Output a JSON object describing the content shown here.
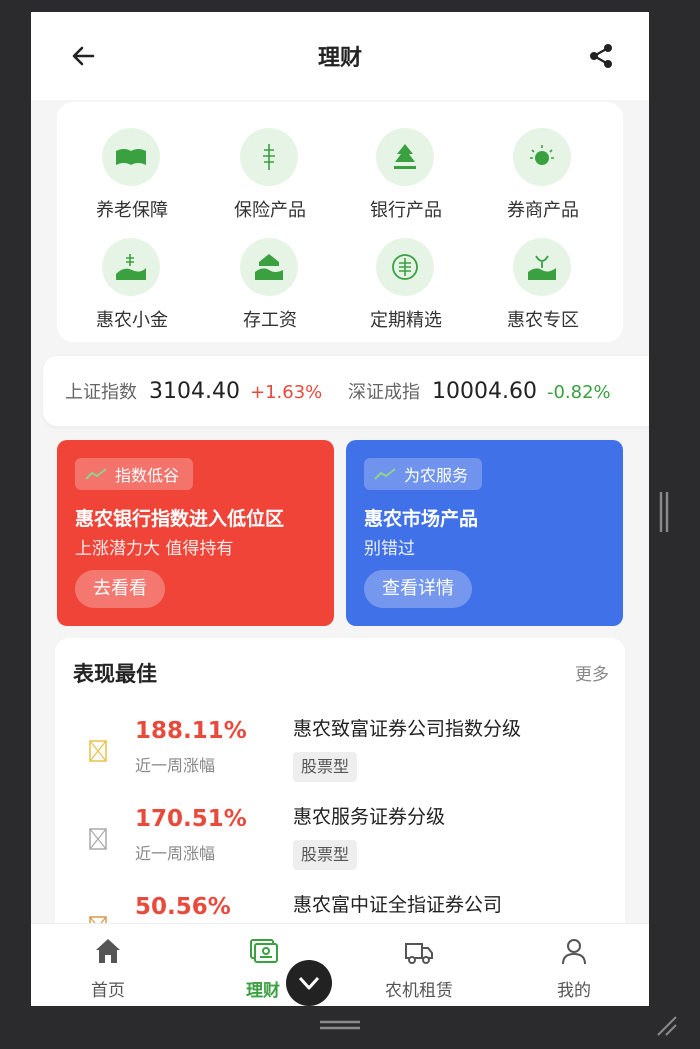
{
  "header": {
    "title": "理财",
    "back_icon": "arrow-left-icon",
    "share_icon": "share-icon"
  },
  "categories": [
    {
      "label": "养老保障",
      "icon": "pension-icon"
    },
    {
      "label": "保险产品",
      "icon": "insurance-icon"
    },
    {
      "label": "银行产品",
      "icon": "bank-icon"
    },
    {
      "label": "券商产品",
      "icon": "broker-icon"
    },
    {
      "label": "惠农小金",
      "icon": "small-gold-icon"
    },
    {
      "label": "存工资",
      "icon": "salary-icon"
    },
    {
      "label": "定期精选",
      "icon": "fixed-term-icon"
    },
    {
      "label": "惠农专区",
      "icon": "zone-icon"
    }
  ],
  "indices": [
    {
      "name": "上证指数",
      "value": "3104.40",
      "change": "+1.63%"
    },
    {
      "name": "深证成指",
      "value": "10004.60",
      "change": "-0.82%"
    }
  ],
  "promos": [
    {
      "tag": "指数低谷",
      "title": "惠农银行指数进入低位区",
      "subtitle": "上涨潜力大 值得持有",
      "button": "去看看",
      "color": "#f04438"
    },
    {
      "tag": "为农服务",
      "title": "惠农市场产品",
      "subtitle": "别错过",
      "button": "查看详情",
      "color": "#4171e8"
    }
  ],
  "best": {
    "title": "表现最佳",
    "more": "更多",
    "items": [
      {
        "pct": "188.11%",
        "period": "近一周涨幅",
        "name": "惠农致富证券公司指数分级",
        "type": "股票型"
      },
      {
        "pct": "170.51%",
        "period": "近一周涨幅",
        "name": "惠农服务证券分级",
        "type": "股票型"
      },
      {
        "pct": "50.56%",
        "period": "",
        "name": "惠农富中证全指证券公司",
        "type": ""
      }
    ]
  },
  "tabs": [
    {
      "label": "首页",
      "icon": "home-icon"
    },
    {
      "label": "理财",
      "icon": "finance-icon",
      "active": true
    },
    {
      "label": "农机租赁",
      "icon": "truck-icon"
    },
    {
      "label": "我的",
      "icon": "user-icon"
    }
  ],
  "colors": {
    "accent": "#3aa040",
    "up": "#e84a3c",
    "down": "#3aa040"
  }
}
